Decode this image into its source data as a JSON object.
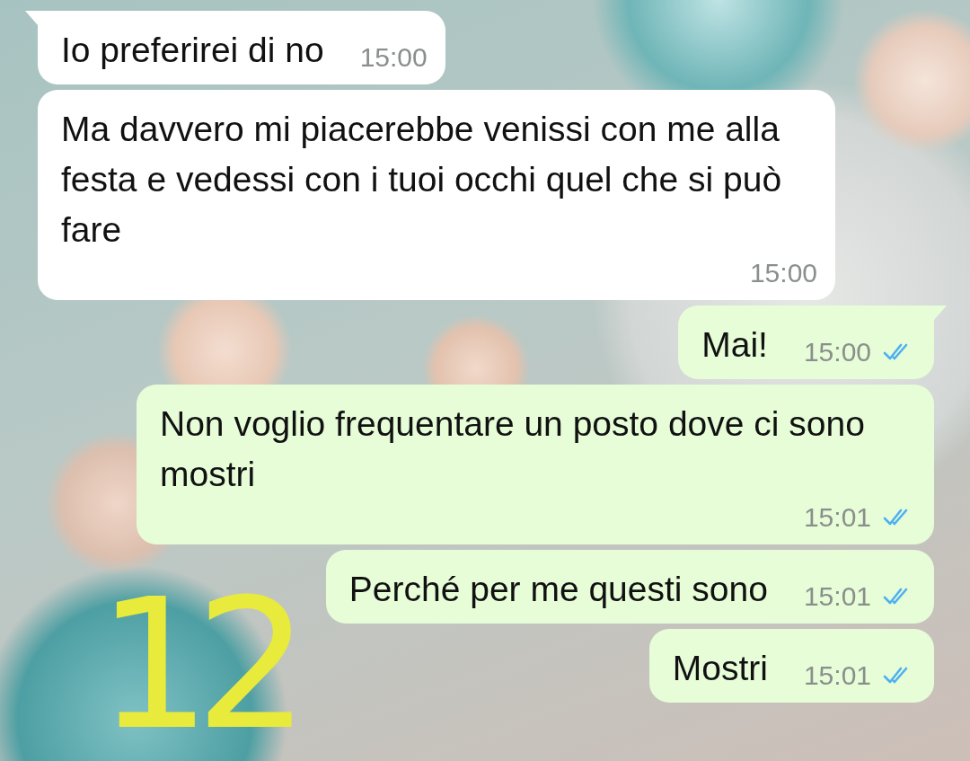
{
  "messages": [
    {
      "outgoing": false,
      "text": "Io preferirei di no",
      "time": "15:00",
      "tail": true
    },
    {
      "outgoing": false,
      "text": "Ma davvero mi piacerebbe venissi con me alla festa e vedessi con i tuoi occhi quel che si può fare",
      "time": "15:00",
      "tail": false
    },
    {
      "outgoing": true,
      "text": "Mai!",
      "time": "15:00",
      "tail": true,
      "read": true
    },
    {
      "outgoing": true,
      "text": "Non voglio frequentare un posto dove ci sono mostri",
      "time": "15:01",
      "tail": false,
      "read": true
    },
    {
      "outgoing": true,
      "text": "Perché per me questi sono",
      "time": "15:01",
      "tail": false,
      "read": true
    },
    {
      "outgoing": true,
      "text": "Mostri",
      "time": "15:01",
      "tail": false,
      "read": true
    }
  ],
  "annotation": "12"
}
